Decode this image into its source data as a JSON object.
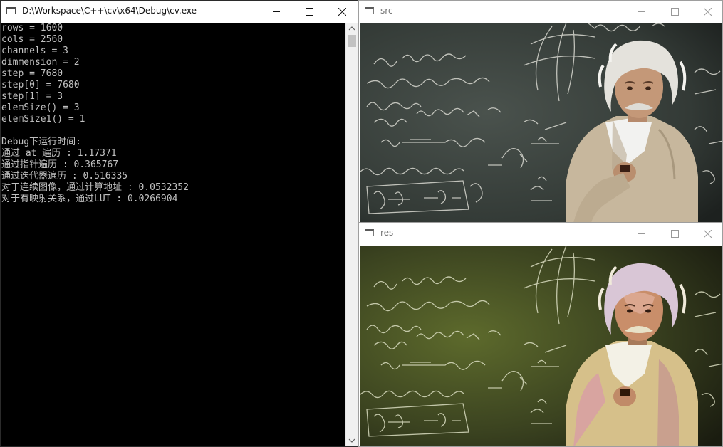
{
  "console": {
    "title": "D:\\Workspace\\C++\\cv\\x64\\Debug\\cv.exe",
    "lines": [
      "rows = 1600",
      "cols = 2560",
      "channels = 3",
      "dimmension = 2",
      "step = 7680",
      "step[0] = 7680",
      "step[1] = 3",
      "elemSize() = 3",
      "elemSize1() = 1",
      "",
      "Debug下运行时间:",
      "通过 at 遍历 : 1.17371",
      "通过指针遍历 : 0.365767",
      "通过迭代器遍历 : 0.516335",
      "对于连续图像，通过计算地址 : 0.0532352",
      "对于有映射关系，通过LUT : 0.0266904"
    ]
  },
  "src_window": {
    "title": "src"
  },
  "res_window": {
    "title": "res"
  },
  "icons": [
    "console-app-icon",
    "opencv-window-icon",
    "minimize-icon",
    "maximize-icon",
    "close-icon",
    "scroll-up-arrow-icon",
    "scroll-down-arrow-icon"
  ],
  "colors": {
    "console_bg": "#000000",
    "console_text": "#c0c0c0",
    "titlebar_bg": "#ffffff",
    "chalkboard": "#3c443f",
    "res_tint": "#56602a"
  }
}
